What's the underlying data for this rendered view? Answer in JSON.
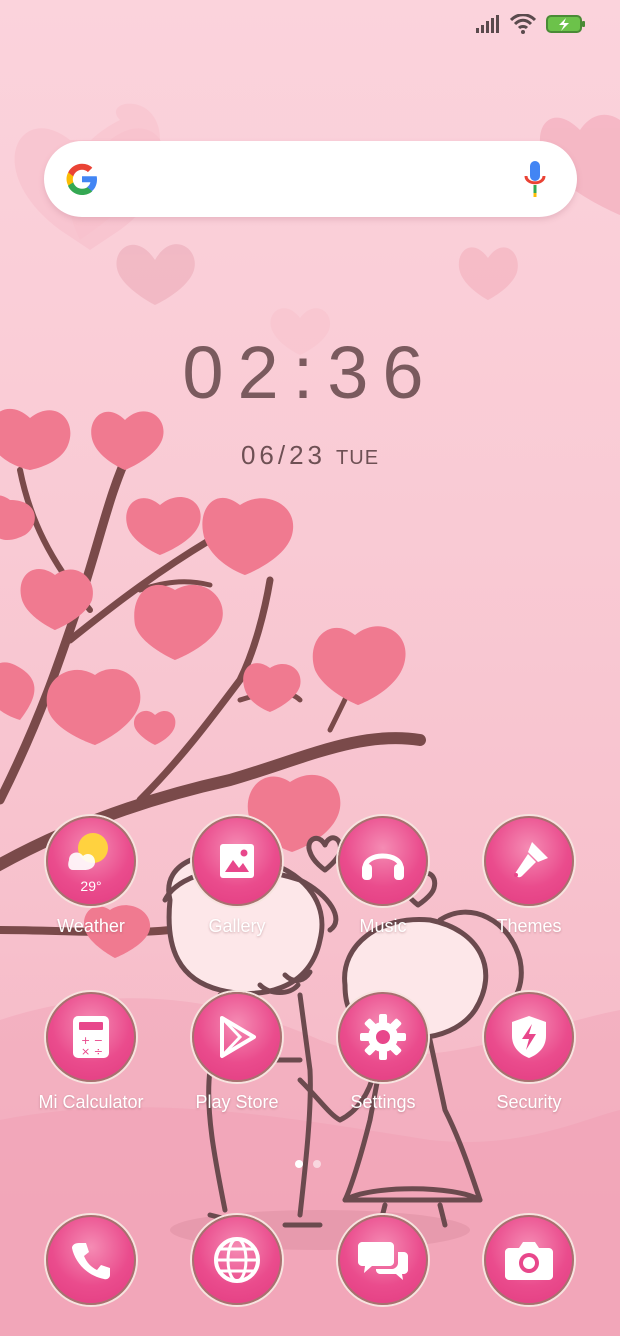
{
  "status": {
    "icons": [
      "signal-icon",
      "wifi-icon",
      "battery-charging-icon"
    ]
  },
  "search": {
    "placeholder": ""
  },
  "clock": {
    "time": "02:36",
    "date": "06/23",
    "weekday": "TUE"
  },
  "weather": {
    "temp": "29°"
  },
  "apps_row1": [
    {
      "label": "Weather",
      "icon": "weather-icon"
    },
    {
      "label": "Gallery",
      "icon": "gallery-icon"
    },
    {
      "label": "Music",
      "icon": "headphones-icon"
    },
    {
      "label": "Themes",
      "icon": "paintbrush-icon"
    }
  ],
  "apps_row2": [
    {
      "label": "Mi Calculator",
      "icon": "calculator-icon"
    },
    {
      "label": "Play Store",
      "icon": "play-store-icon"
    },
    {
      "label": "Settings",
      "icon": "gear-icon"
    },
    {
      "label": "Security",
      "icon": "shield-icon"
    }
  ],
  "dock": [
    {
      "icon": "phone-icon"
    },
    {
      "icon": "browser-globe-icon"
    },
    {
      "icon": "messages-icon"
    },
    {
      "icon": "camera-icon"
    }
  ],
  "pages": {
    "count": 2,
    "current": 1
  },
  "colors": {
    "accent": "#e8478b",
    "text": "#7a5a5e"
  }
}
